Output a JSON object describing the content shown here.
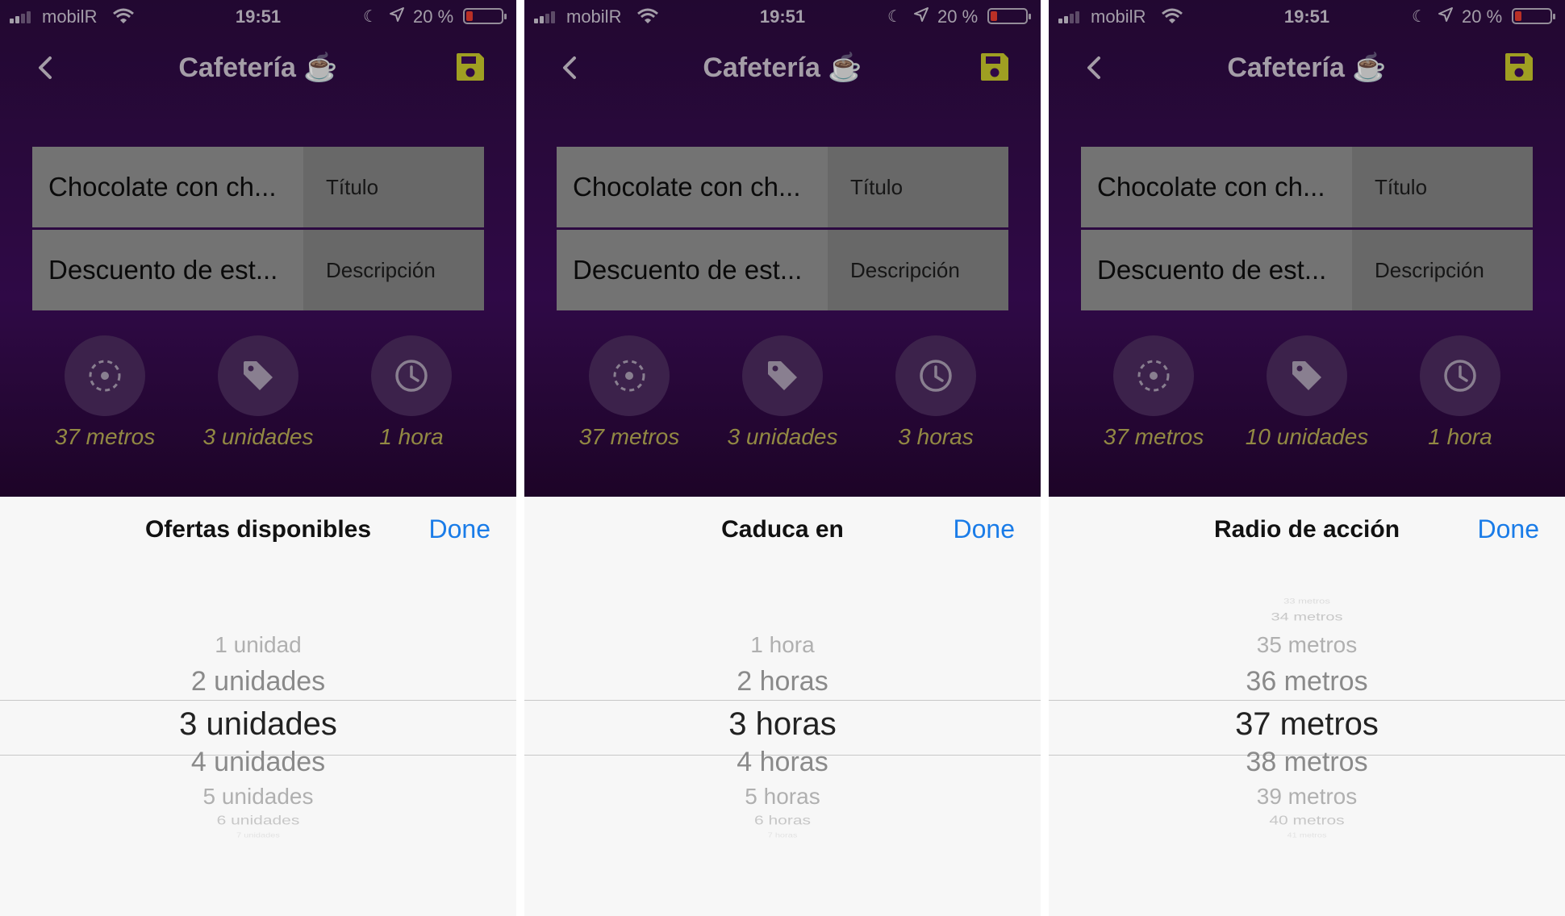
{
  "colors": {
    "accent": "#1a7ce8",
    "caption": "#b2a852",
    "save_icon": "#c3c22a",
    "app_bg": "#3a0c56"
  },
  "screens": [
    {
      "status": {
        "carrier": "mobilR",
        "time": "19:51",
        "battery": "20 %",
        "battery_level": 0.2
      },
      "nav": {
        "title": "Cafetería ☕"
      },
      "fields": [
        {
          "value": "Chocolate con ch...",
          "label": "Título"
        },
        {
          "value": "Descuento de est...",
          "label": "Descripción"
        }
      ],
      "meta": [
        {
          "icon": "target-icon",
          "caption": "37 metros"
        },
        {
          "icon": "tag-icon",
          "caption": "3 unidades"
        },
        {
          "icon": "clock-icon",
          "caption": "1 hora"
        }
      ],
      "picker": {
        "title": "Ofertas disponibles",
        "done": "Done",
        "options": [
          "1 unidad",
          "2 unidades",
          "3 unidades",
          "4 unidades",
          "5 unidades",
          "6 unidades",
          "7 unidades"
        ],
        "selected": "3 unidades"
      }
    },
    {
      "status": {
        "carrier": "mobilR",
        "time": "19:51",
        "battery": "20 %",
        "battery_level": 0.2
      },
      "nav": {
        "title": "Cafetería ☕"
      },
      "fields": [
        {
          "value": "Chocolate con ch...",
          "label": "Título"
        },
        {
          "value": "Descuento de est...",
          "label": "Descripción"
        }
      ],
      "meta": [
        {
          "icon": "target-icon",
          "caption": "37 metros"
        },
        {
          "icon": "tag-icon",
          "caption": "3 unidades"
        },
        {
          "icon": "clock-icon",
          "caption": "3 horas"
        }
      ],
      "picker": {
        "title": "Caduca en",
        "done": "Done",
        "options": [
          "1 hora",
          "2 horas",
          "3 horas",
          "4 horas",
          "5 horas",
          "6 horas",
          "7 horas"
        ],
        "selected": "3 horas"
      }
    },
    {
      "status": {
        "carrier": "mobilR",
        "time": "19:51",
        "battery": "20 %",
        "battery_level": 0.2
      },
      "nav": {
        "title": "Cafetería ☕"
      },
      "fields": [
        {
          "value": "Chocolate con ch...",
          "label": "Título"
        },
        {
          "value": "Descuento de est...",
          "label": "Descripción"
        }
      ],
      "meta": [
        {
          "icon": "target-icon",
          "caption": "37 metros"
        },
        {
          "icon": "tag-icon",
          "caption": "10 unidades"
        },
        {
          "icon": "clock-icon",
          "caption": "1 hora"
        }
      ],
      "picker": {
        "title": "Radio de acción",
        "done": "Done",
        "options": [
          "33 metros",
          "34 metros",
          "35 metros",
          "36 metros",
          "37 metros",
          "38 metros",
          "39 metros",
          "40 metros",
          "41 metros"
        ],
        "selected": "37 metros"
      }
    }
  ]
}
